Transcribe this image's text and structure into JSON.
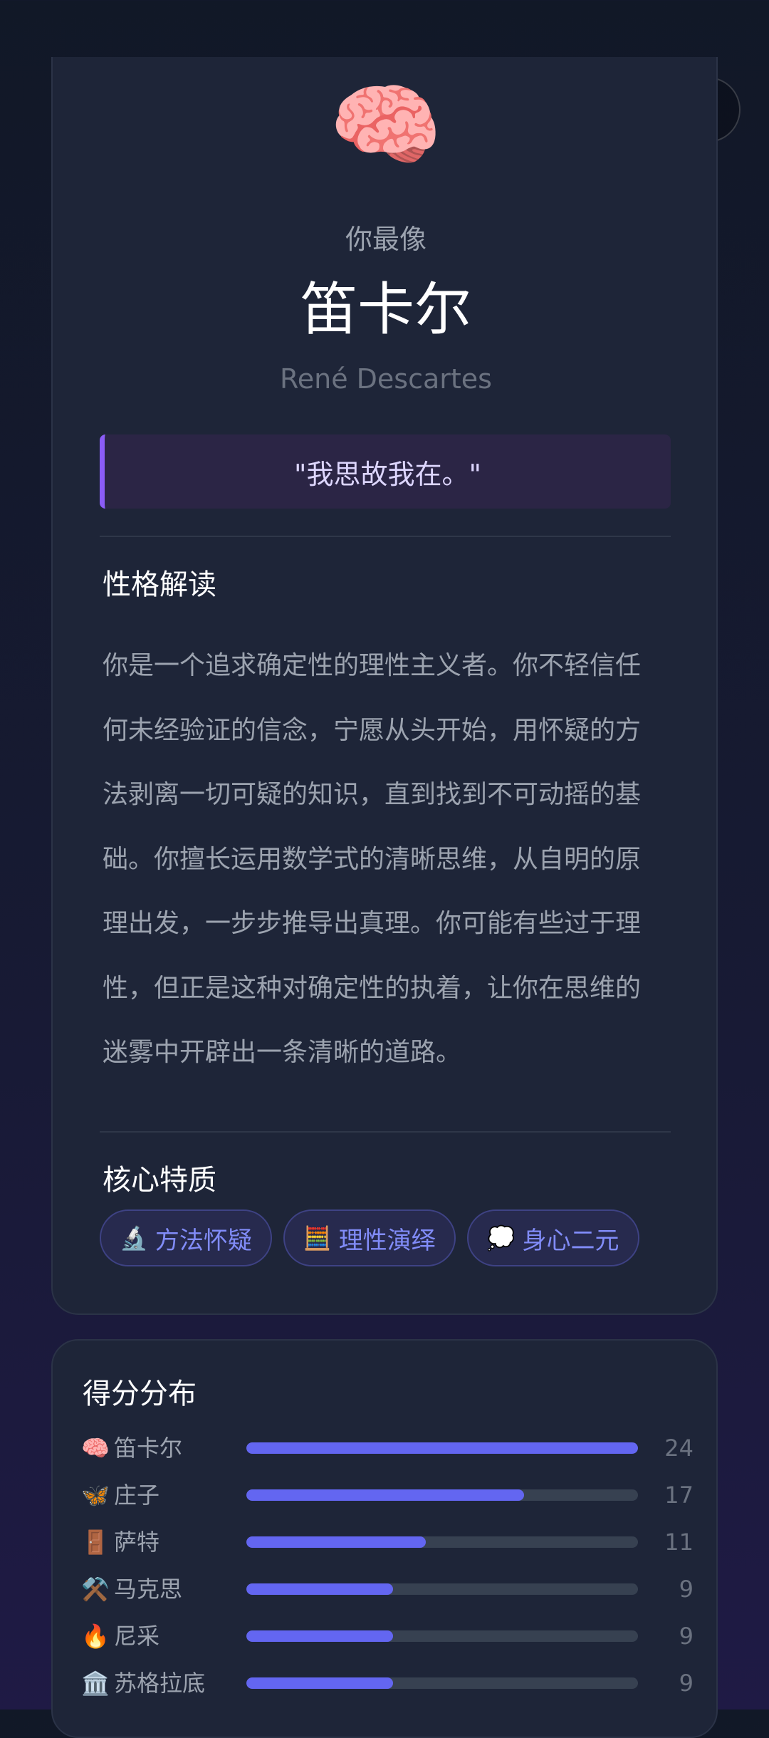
{
  "capsule": {
    "more_icon": "more-dots-icon",
    "close_icon": "target-close-icon"
  },
  "result": {
    "emoji": "🧠",
    "intro": "你最像",
    "name": "笛卡尔",
    "name_en": "René Descartes",
    "quote": "\"我思故我在。\"",
    "personality_title": "性格解读",
    "description": "你是一个追求确定性的理性主义者。你不轻信任何未经验证的信念，宁愿从头开始，用怀疑的方法剥离一切可疑的知识，直到找到不可动摇的基础。你擅长运用数学式的清晰思维，从自明的原理出发，一步步推导出真理。你可能有些过于理性，但正是这种对确定性的执着，让你在思维的迷雾中开辟出一条清晰的道路。",
    "traits_title": "核心特质",
    "traits": [
      {
        "icon": "🔬",
        "label": "方法怀疑"
      },
      {
        "icon": "🧮",
        "label": "理性演绎"
      },
      {
        "icon": "💭",
        "label": "身心二元"
      }
    ]
  },
  "scores": {
    "title": "得分分布",
    "max": 24,
    "items": [
      {
        "icon": "🧠",
        "name": "笛卡尔",
        "score": 24
      },
      {
        "icon": "🦋",
        "name": "庄子",
        "score": 17
      },
      {
        "icon": "🚪",
        "name": "萨特",
        "score": 11
      },
      {
        "icon": "⚒️",
        "name": "马克思",
        "score": 9
      },
      {
        "icon": "🔥",
        "name": "尼采",
        "score": 9
      },
      {
        "icon": "🏛️",
        "name": "苏格拉底",
        "score": 9
      }
    ]
  },
  "colors": {
    "accent": "#6366f1",
    "quote_border": "#8b5cf6",
    "card_bg": "#1e2538",
    "track_bg": "#374151"
  }
}
